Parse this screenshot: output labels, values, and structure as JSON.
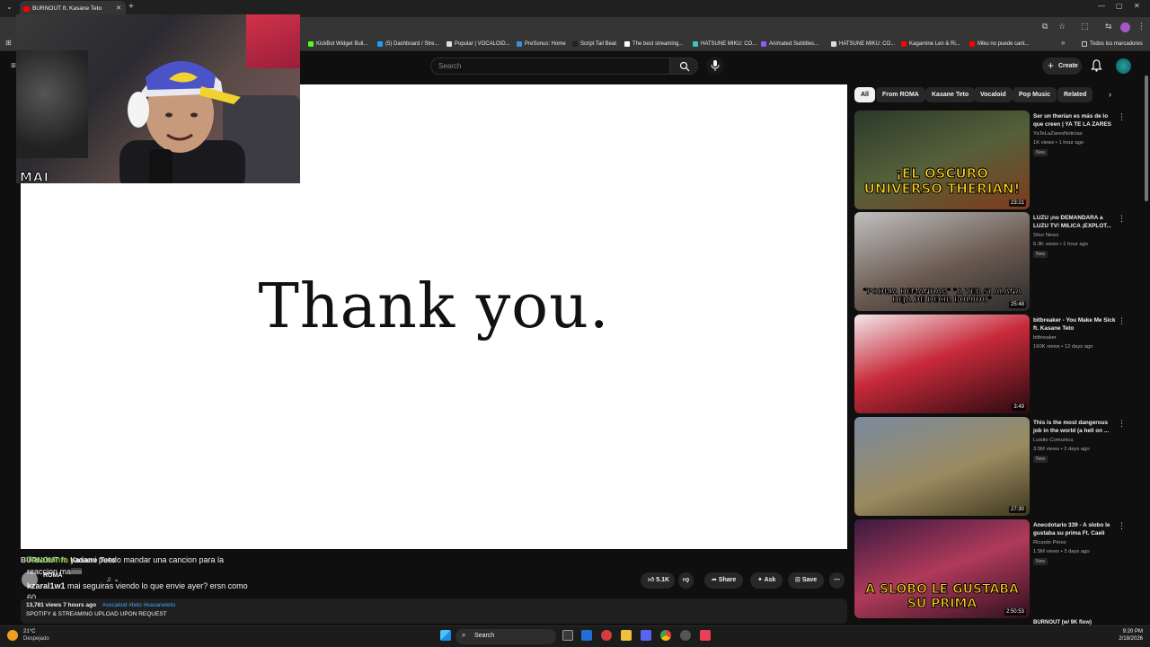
{
  "browser": {
    "tab_title": "BURNOUT ft. Kasane Teto",
    "tab_close": "✕",
    "new_tab": "+",
    "all_bookmarks": "Todos los marcadores",
    "bookmarks": [
      {
        "label": "KickBot Widget Buil...",
        "color": "#53fc18"
      },
      {
        "label": "(5) Dashboard / Stre...",
        "color": "#1da1f2"
      },
      {
        "label": "Popular | VOCALOID...",
        "color": "#e0e0e0"
      },
      {
        "label": "PreSonus: Home",
        "color": "#3a8fd9"
      },
      {
        "label": "Script Tail Beat",
        "color": "#222222"
      },
      {
        "label": "The best streaming...",
        "color": "#ffffff"
      },
      {
        "label": "HATSUNE MIKU: CO...",
        "color": "#39c5bb"
      },
      {
        "label": "Animated Subtitles...",
        "color": "#8a5cf6"
      },
      {
        "label": "HATSUNE MIKU: CO...",
        "color": "#dddddd"
      },
      {
        "label": "Kagamine Len & Ri...",
        "color": "#ff0000"
      },
      {
        "label": "Miku no puede cant...",
        "color": "#ff0000"
      }
    ]
  },
  "webcam": {
    "overlay_text": "MAI"
  },
  "youtube": {
    "search_placeholder": "Search",
    "create_label": "Create",
    "chips": [
      "All",
      "From ROMA",
      "Kasane Teto",
      "Vocaloid",
      "Pop Music",
      "Related"
    ],
    "player_text": "Thank you.",
    "recommended": [
      {
        "title": "Ser un therian es más de lo que creen | YA TE LA ZARES",
        "channel": "YaTeLaZaresNoticias",
        "meta": "1K views • 1 hour ago",
        "badge": "New",
        "duration": "23:21",
        "thumb_text": "¡EL OSCURO UNIVERSO THERIAN!"
      },
      {
        "title": "LUZU ¡no DEMANDARA a LUZU TV! MILICA ¡EXPLOT...",
        "channel": "Shur News",
        "meta": "6.3K views • 1 hour ago",
        "badge": "New",
        "duration": "25:48",
        "thumb_text": "\"PODRIA DEMANDAR\" \"A VER SI ALANA DEJA DE DECIR BOLUDO\""
      },
      {
        "title": "bitbreaker - You Make Me Sick ft. Kasane Teto",
        "channel": "bitbreaker",
        "meta": "160K views • 12 days ago",
        "badge": "",
        "duration": "3:49",
        "thumb_text": ""
      },
      {
        "title": "This is the most dangerous job in the world (a hell on ...",
        "channel": "Luisito Comunica",
        "meta": "3.5M views • 2 days ago",
        "badge": "New",
        "duration": "27:30",
        "thumb_text": ""
      },
      {
        "title": "Anecdotario 339 - A slobo le gustaba su prima Ft. Caeli",
        "channel": "Ricardo Pérez",
        "meta": "1.5M views • 3 days ago",
        "badge": "New",
        "duration": "2:50:53",
        "thumb_text": "A SLOBO LE GUSTABA SU PRIMA"
      }
    ],
    "video_title": "BURNOUT ft. Kasane Teto",
    "channel_name": "ROMA",
    "likes": "5.1K",
    "share_label": "Share",
    "ask_label": "Ask",
    "save_label": "Save",
    "description_stats": "13,781 views  7 hours ago",
    "description_tags": "#vocaloid #teto #kasaneteto",
    "description_line2": "SPOTIFY & STREAMING UPLOAD UPON REQUEST",
    "next_peek": "BURNOUT (w/ 9K flow)"
  },
  "chat": [
    {
      "user": "Tenebrinfo",
      "text": "yadami puedo mandar una cancion para la reaccion maiiiiii",
      "color": "#6fbf3a"
    },
    {
      "user": "kzaral1w1",
      "text": "mai seguiras viendo lo que envie ayer? ersn como 60",
      "color": "#e6e6e6"
    }
  ],
  "taskbar": {
    "weather_temp": "21°C",
    "weather_desc": "Despejado",
    "search_label": "Search",
    "time": "9:20 PM",
    "date": "2/18/2026"
  }
}
